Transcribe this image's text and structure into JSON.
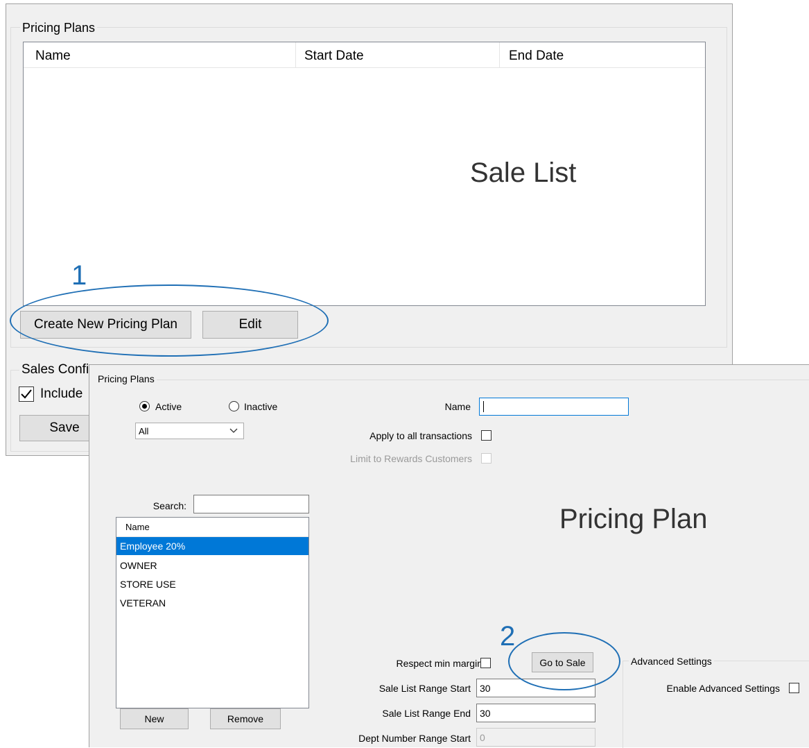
{
  "sale_list_window": {
    "group_title": "Pricing Plans",
    "columns": [
      "Name",
      "Start Date",
      "End Date"
    ],
    "create_button": "Create New Pricing Plan",
    "edit_button": "Edit",
    "sales_config_title": "Sales Confi",
    "include_label": "Include",
    "include_checked": true,
    "save_button": "Save"
  },
  "callouts": {
    "sale_list_label": "Sale List",
    "pricing_plan_label": "Pricing Plan",
    "step1": "1",
    "step2": "2"
  },
  "pricing_plan_window": {
    "group_title": "Pricing Plans",
    "radio_active": "Active",
    "radio_inactive": "Inactive",
    "active_selected": true,
    "filter_value": "All",
    "name_label": "Name",
    "name_value": "",
    "apply_all_label": "Apply to all transactions",
    "limit_rewards_label": "Limit to Rewards Customers",
    "search_label": "Search:",
    "search_value": "",
    "list_header": "Name",
    "list_items": [
      "Employee 20%",
      "OWNER",
      "STORE USE",
      "VETERAN"
    ],
    "selected_index": 0,
    "new_button": "New",
    "remove_button": "Remove",
    "respect_margin_label": "Respect min margin",
    "go_to_sale_button": "Go to Sale",
    "advanced_title": "Advanced Settings",
    "enable_advanced_label": "Enable Advanced Settings",
    "sale_start_label": "Sale List Range Start",
    "sale_start_value": "30",
    "sale_end_label": "Sale List Range End",
    "sale_end_value": "30",
    "dept_start_label": "Dept Number Range Start",
    "dept_start_value": "0"
  },
  "colors": {
    "accent": "#1f6fb5",
    "selection": "#0078d7",
    "window_bg": "#f0f0f0"
  }
}
